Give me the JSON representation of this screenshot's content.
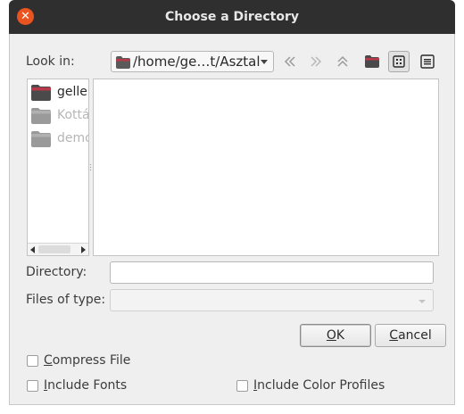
{
  "window": {
    "title": "Choose a Directory"
  },
  "look_in": {
    "label": "Look in:",
    "path": "/home/ge…t/Asztal"
  },
  "toolbar": {
    "icons": [
      "back-icon",
      "forward-icon",
      "parent-directory-icon",
      "new-folder-icon",
      "icon-view-icon",
      "detail-view-icon"
    ],
    "active_view": "icon-view"
  },
  "sidebar": {
    "items": [
      {
        "label": "geller",
        "enabled": true
      },
      {
        "label": "Kottá",
        "enabled": false
      },
      {
        "label": "demo",
        "enabled": false
      }
    ]
  },
  "directory": {
    "label": "Directory:",
    "value": ""
  },
  "files_of_type": {
    "label": "Files of type:",
    "value": ""
  },
  "buttons": {
    "ok": {
      "mnemonic": "O",
      "rest": "K"
    },
    "cancel": {
      "mnemonic": "C",
      "rest": "ancel"
    }
  },
  "options": {
    "compress_file": {
      "mnemonic": "C",
      "rest": "ompress File",
      "checked": false
    },
    "include_fonts": {
      "mnemonic": "I",
      "rest": "nclude Fonts",
      "checked": false
    },
    "include_color_profiles": {
      "mnemonic": "I",
      "rest": "nclude Color Profiles",
      "checked": false
    }
  },
  "colors": {
    "titlebar": "#2f2f2f",
    "close": "#e95420",
    "folder_home": "#b83a4a",
    "folder_gray": "#8a8a8a"
  }
}
